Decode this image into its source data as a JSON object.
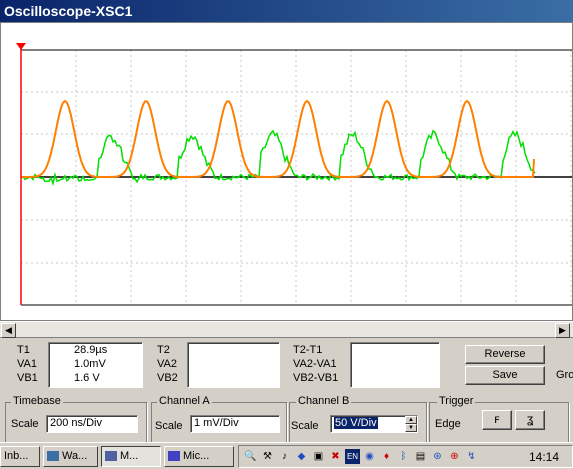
{
  "window": {
    "title": "Oscilloscope-XSC1"
  },
  "readout": {
    "col1_labels": [
      "T1",
      "VA1",
      "VB1"
    ],
    "col1_values": [
      "28.9µs",
      "1.0mV",
      "1.6 V"
    ],
    "col2_labels": [
      "T2",
      "VA2",
      "VB2"
    ],
    "col2_values": [
      "",
      "",
      ""
    ],
    "col3_labels": [
      "T2-T1",
      "VA2-VA1",
      "VB2-VB1"
    ],
    "col3_values": [
      "",
      "",
      ""
    ]
  },
  "buttons": {
    "reverse": "Reverse",
    "save": "Save",
    "gnd_partial": "Gro"
  },
  "timebase": {
    "title": "Timebase",
    "scale_label": "Scale",
    "scale_value": "200 ns/Div"
  },
  "channel_a": {
    "title": "Channel A",
    "scale_label": "Scale",
    "scale_value": "1 mV/Div"
  },
  "channel_b": {
    "title": "Channel B",
    "scale_label": "Scale",
    "scale_value": "50 V/Div"
  },
  "trigger": {
    "title": "Trigger",
    "edge_label": "Edge",
    "rising_icon": "rising-edge-icon",
    "falling_icon": "falling-edge-icon"
  },
  "taskbar": {
    "tasks": [
      {
        "label": "Inb..."
      },
      {
        "label": "Wa..."
      },
      {
        "label": "M..."
      },
      {
        "label": "Mic..."
      }
    ],
    "clock": "14:14"
  },
  "colors": {
    "channel_a": "#ff7f00",
    "channel_b": "#00e000",
    "cursor": "#ff0000",
    "grid": "#c8c8c8",
    "title_bar": "#0a246a"
  }
}
